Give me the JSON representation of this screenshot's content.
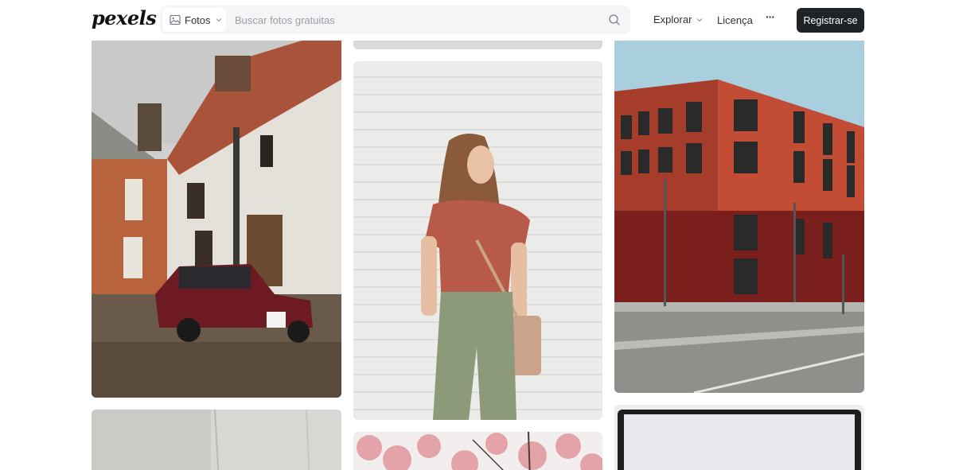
{
  "header": {
    "logo_text": "pexels",
    "search": {
      "type_label": "Fotos",
      "placeholder": "Buscar fotos gratuitas",
      "value": ""
    },
    "nav": {
      "explore_label": "Explorar",
      "license_label": "Licença",
      "more_label": "···",
      "join_label": "Registrar-se"
    }
  },
  "colors": {
    "join_button_bg": "#1f2226",
    "search_bg": "#f4f5f6"
  },
  "icons": {
    "search_type": "image-icon",
    "dropdown": "chevron-down-icon",
    "search": "search-icon",
    "more": "ellipsis-icon"
  }
}
